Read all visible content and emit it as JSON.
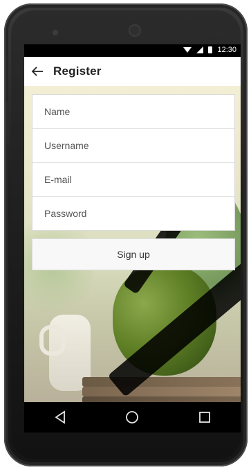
{
  "status_bar": {
    "time": "12:30",
    "icons": [
      "wifi-icon",
      "signal-icon",
      "battery-icon"
    ]
  },
  "app_bar": {
    "title": "Register",
    "back_icon": "arrow-left-icon"
  },
  "form": {
    "fields": [
      {
        "name": "Name",
        "placeholder": "Name",
        "value": ""
      },
      {
        "name": "Username",
        "placeholder": "Username",
        "value": ""
      },
      {
        "name": "E-mail",
        "placeholder": "E-mail",
        "value": ""
      },
      {
        "name": "Password",
        "placeholder": "Password",
        "value": ""
      }
    ],
    "submit_label": "Sign up"
  },
  "nav_bar": {
    "buttons": [
      "back-triangle-icon",
      "home-circle-icon",
      "recent-square-icon"
    ]
  },
  "colors": {
    "app_bar_bg": "#ffffff",
    "status_bar_bg": "#000000",
    "nav_bar_bg": "#000000",
    "button_bg": "#f8f8f8"
  }
}
